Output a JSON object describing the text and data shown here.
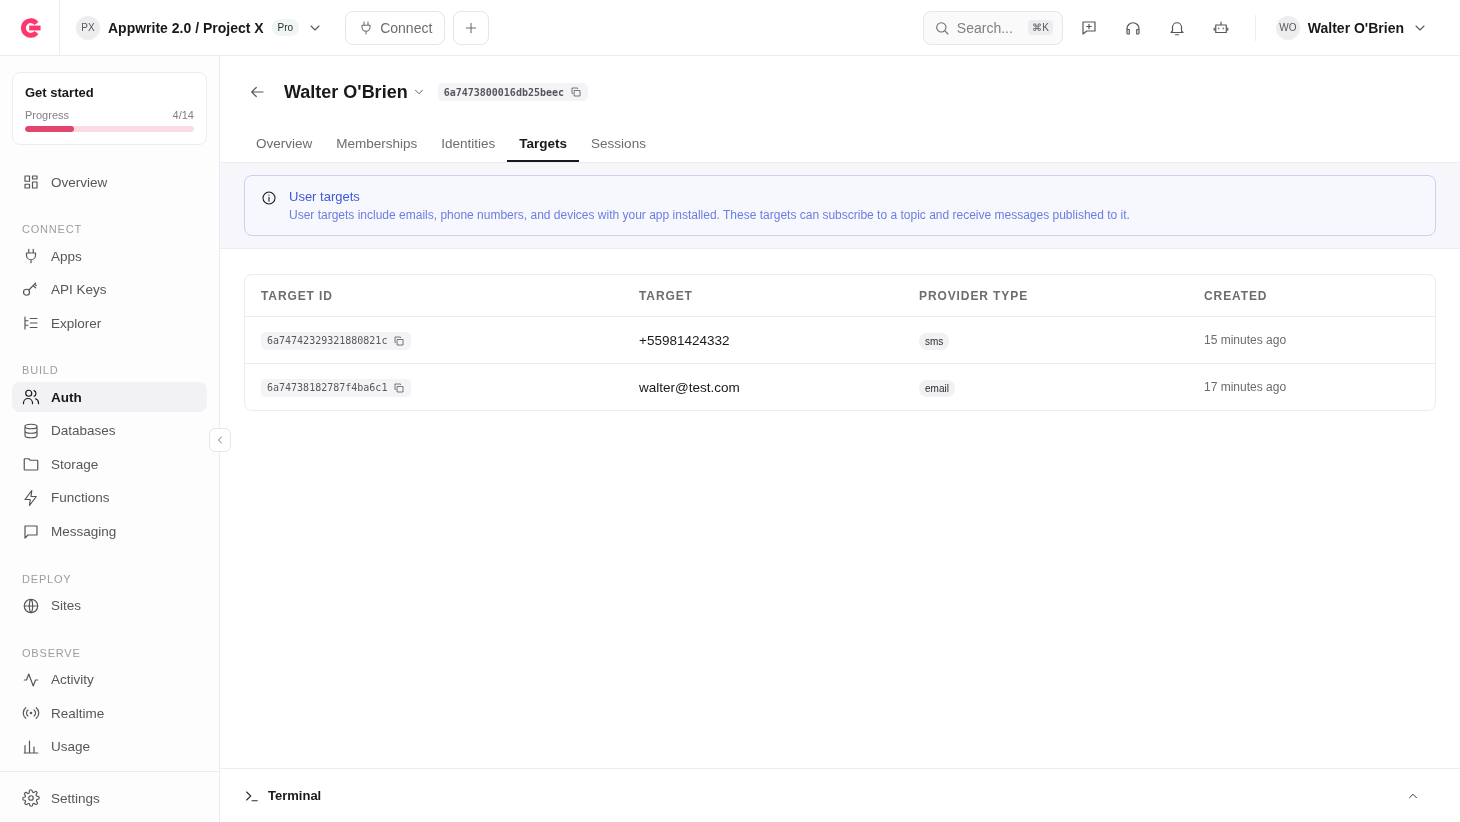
{
  "topbar": {
    "project": {
      "avatar": "PX",
      "name": "Appwrite 2.0 / Project X",
      "plan": "Pro"
    },
    "connect": "Connect",
    "search": {
      "placeholder": "Search...",
      "shortcut": "⌘K"
    },
    "user": {
      "avatar": "WO",
      "name": "Walter O'Brien"
    }
  },
  "sidebar": {
    "get_started": {
      "title": "Get started",
      "label": "Progress",
      "count": "4/14",
      "level": 0.29
    },
    "sections": [
      {
        "items": [
          {
            "label": "Overview",
            "selected": false
          }
        ]
      },
      {
        "heading": "CONNECT",
        "items": [
          {
            "label": "Apps",
            "selected": false
          },
          {
            "label": "API Keys",
            "selected": false
          },
          {
            "label": "Explorer",
            "selected": false
          }
        ]
      },
      {
        "heading": "BUILD",
        "items": [
          {
            "label": "Auth",
            "selected": true
          },
          {
            "label": "Databases",
            "selected": false
          },
          {
            "label": "Storage",
            "selected": false
          },
          {
            "label": "Functions",
            "selected": false
          },
          {
            "label": "Messaging",
            "selected": false
          }
        ]
      },
      {
        "heading": "DEPLOY",
        "items": [
          {
            "label": "Sites",
            "selected": false
          }
        ]
      },
      {
        "heading": "OBSERVE",
        "items": [
          {
            "label": "Activity",
            "selected": false
          },
          {
            "label": "Realtime",
            "selected": false
          },
          {
            "label": "Usage",
            "selected": false
          }
        ]
      }
    ],
    "footer": "Settings"
  },
  "page": {
    "title": "Walter O'Brien",
    "id": "6a7473800016db25beec",
    "tabs": [
      {
        "label": "Overview",
        "selected": false
      },
      {
        "label": "Memberships",
        "selected": false
      },
      {
        "label": "Identities",
        "selected": false
      },
      {
        "label": "Targets",
        "selected": true
      },
      {
        "label": "Sessions",
        "selected": false
      }
    ],
    "alert": {
      "title": "User targets",
      "text": "User targets include emails, phone numbers, and devices with your app installed. These targets can subscribe to a topic and receive messages published to it."
    },
    "table": {
      "columns": [
        "TARGET ID",
        "TARGET",
        "PROVIDER TYPE",
        "CREATED"
      ],
      "rows": [
        {
          "target_id": "6a74742329321880821c",
          "target": "+55981424332",
          "provider_type": "sms",
          "created": "15 minutes ago"
        },
        {
          "target_id": "6a74738182787f4ba6c1",
          "target": "walter@test.com",
          "provider_type": "email",
          "created": "17 minutes ago"
        }
      ]
    }
  },
  "terminal": {
    "label": "Terminal"
  }
}
